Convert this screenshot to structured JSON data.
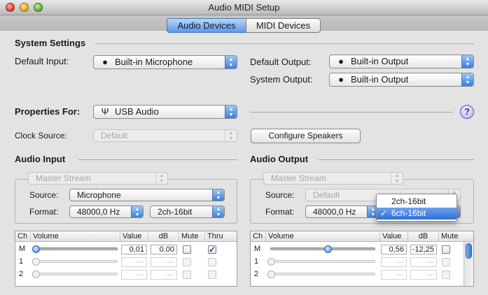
{
  "window": {
    "title": "Audio MIDI Setup"
  },
  "tabs": [
    {
      "label": "Audio Devices",
      "active": true
    },
    {
      "label": "MIDI Devices",
      "active": false
    }
  ],
  "system_settings": {
    "heading": "System Settings",
    "default_input_label": "Default Input:",
    "default_input_value": "Built-in Microphone",
    "default_output_label": "Default Output:",
    "default_output_value": "Built-in Output",
    "system_output_label": "System Output:",
    "system_output_value": "Built-in Output",
    "apple_icon": "apple-icon"
  },
  "properties": {
    "label": "Properties For:",
    "value": "USB Audio",
    "usb_icon": "usb-icon",
    "help": "?"
  },
  "clock": {
    "label": "Clock Source:",
    "value": "Default",
    "configure_button": "Configure Speakers"
  },
  "audio_input": {
    "heading": "Audio Input",
    "stream": "Master Stream",
    "source_label": "Source:",
    "source_value": "Microphone",
    "format_label": "Format:",
    "format_rate": "48000,0 Hz",
    "format_channels": "2ch-16bit",
    "columns": [
      "Ch",
      "Volume",
      "Value",
      "dB",
      "Mute",
      "Thru"
    ],
    "rows": [
      {
        "ch": "M",
        "volume": 0.0,
        "value": "0,01",
        "db": "0.00",
        "mute": false,
        "thru": true,
        "enabled": true
      },
      {
        "ch": "1",
        "volume": 0.0,
        "value": "—",
        "db": "—",
        "mute": false,
        "thru": false,
        "enabled": false
      },
      {
        "ch": "2",
        "volume": 0.0,
        "value": "—",
        "db": "—",
        "mute": false,
        "thru": false,
        "enabled": false
      }
    ]
  },
  "audio_output": {
    "heading": "Audio Output",
    "stream": "Master Stream",
    "source_label": "Source:",
    "source_value": "Default",
    "format_label": "Format:",
    "format_rate": "48000,0 Hz",
    "columns": [
      "Ch",
      "Volume",
      "Value",
      "dB",
      "Mute"
    ],
    "rows": [
      {
        "ch": "M",
        "volume": 0.56,
        "value": "0,56",
        "db": "-12,25",
        "mute": false,
        "enabled": true
      },
      {
        "ch": "1",
        "volume": 0.0,
        "value": "—",
        "db": "—",
        "mute": false,
        "enabled": false
      },
      {
        "ch": "2",
        "volume": 0.0,
        "value": "—",
        "db": "—",
        "mute": false,
        "enabled": false
      }
    ],
    "format_menu": {
      "items": [
        {
          "label": "2ch-16bit",
          "selected": false
        },
        {
          "label": "6ch-16bit",
          "selected": true
        }
      ],
      "checkmark": "✓"
    }
  },
  "colors": {
    "accent": "#3d7fd8",
    "window": "#e3e3e3"
  }
}
